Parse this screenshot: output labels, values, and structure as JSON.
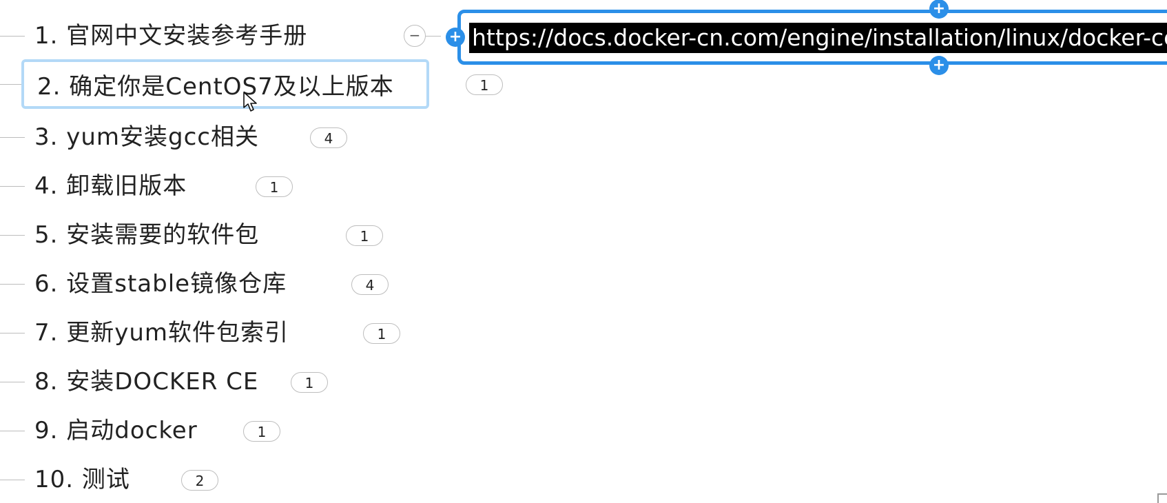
{
  "link_node": {
    "url": "https://docs.docker-cn.com/engine/installation/linux/docker-ce/",
    "add_handle_top": "+",
    "add_handle_bottom": "+",
    "add_handle_left": "+",
    "collapse_symbol": "−"
  },
  "topics": [
    {
      "label": "1. 官网中文安装参考手册",
      "badge": ""
    },
    {
      "label": "2. 确定你是CentOS7及以上版本",
      "badge": "1"
    },
    {
      "label": "3. yum安装gcc相关",
      "badge": "4"
    },
    {
      "label": "4. 卸载旧版本",
      "badge": "1"
    },
    {
      "label": "5. 安装需要的软件包",
      "badge": "1"
    },
    {
      "label": "6. 设置stable镜像仓库",
      "badge": "4"
    },
    {
      "label": "7. 更新yum软件包索引",
      "badge": "1"
    },
    {
      "label": "8. 安装DOCKER CE",
      "badge": "1"
    },
    {
      "label": "9. 启动docker",
      "badge": "1"
    },
    {
      "label": "10. 测试",
      "badge": "2"
    }
  ],
  "icons": {
    "cursor": "mouse-pointer-icon"
  }
}
